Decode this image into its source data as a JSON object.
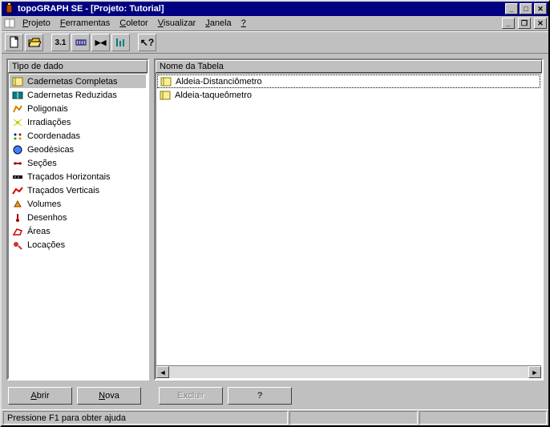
{
  "titlebar": {
    "title": "topoGRAPH SE - [Projeto: Tutorial]"
  },
  "menubar": {
    "projeto": "Projeto",
    "ferramentas": "Ferramentas",
    "coletor": "Coletor",
    "visualizar": "Visualizar",
    "janela": "Janela",
    "help": "?"
  },
  "toolbar": {
    "version": "3.1"
  },
  "left": {
    "header": "Tipo de dado",
    "items": [
      {
        "label": "Cadernetas Completas"
      },
      {
        "label": "Cadernetas Reduzidas"
      },
      {
        "label": "Poligonais"
      },
      {
        "label": "Irradiações"
      },
      {
        "label": "Coordenadas"
      },
      {
        "label": "Geodésicas"
      },
      {
        "label": "Seções"
      },
      {
        "label": "Traçados Horizontais"
      },
      {
        "label": "Traçados Verticais"
      },
      {
        "label": "Volumes"
      },
      {
        "label": "Desenhos"
      },
      {
        "label": "Áreas"
      },
      {
        "label": "Locações"
      }
    ]
  },
  "right": {
    "header": "Nome da Tabela",
    "items": [
      {
        "label": "Aldeia-Distanciômetro"
      },
      {
        "label": "Aldeia-taqueômetro"
      }
    ]
  },
  "buttons": {
    "abrir": "Abrir",
    "nova": "Nova",
    "excluir": "Excluir",
    "help": "?"
  },
  "statusbar": {
    "hint": "Pressione F1 para obter ajuda"
  }
}
